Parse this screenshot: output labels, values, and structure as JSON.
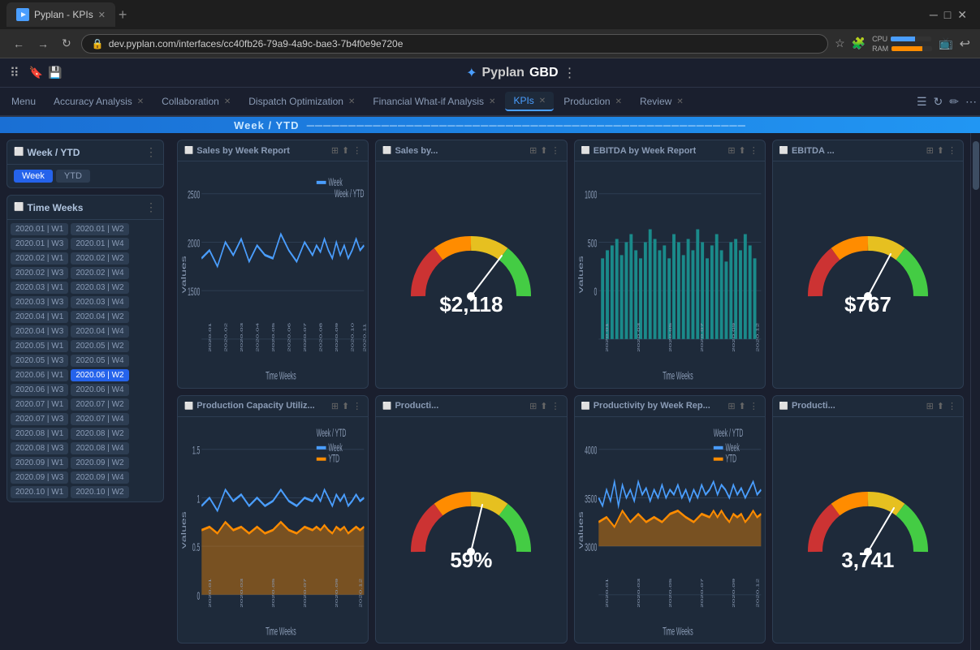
{
  "browser": {
    "tab_title": "Pyplan - KPIs",
    "url": "dev.pyplan.com/interfaces/cc40fb26-79a9-4a9c-bae3-7b4f0e9e720e",
    "new_tab_label": "+"
  },
  "app": {
    "name": "Pyplan",
    "workspace": "GBD",
    "menu_label": "Menu",
    "tabs": [
      {
        "id": "accuracy",
        "label": "Accuracy Analysis",
        "closable": true
      },
      {
        "id": "collaboration",
        "label": "Collaboration",
        "closable": true
      },
      {
        "id": "dispatch",
        "label": "Dispatch Optimization",
        "closable": true
      },
      {
        "id": "financial",
        "label": "Financial What-if Analysis",
        "closable": true
      },
      {
        "id": "kpis",
        "label": "KPIs",
        "closable": true,
        "active": true
      },
      {
        "id": "production",
        "label": "Production",
        "closable": true
      },
      {
        "id": "review",
        "label": "Review",
        "closable": true
      }
    ]
  },
  "banner": {
    "text": "Week / YTD"
  },
  "sidebar": {
    "week_ytd": {
      "title": "Week / YTD",
      "btn_week": "Week",
      "btn_ytd": "YTD"
    },
    "time_weeks": {
      "title": "Time Weeks"
    },
    "weeks": [
      "2020.01 | W1",
      "2020.01 | W2",
      "2020.01 | W3",
      "2020.01 | W4",
      "2020.02 | W1",
      "2020.02 | W2",
      "2020.02 | W3",
      "2020.02 | W4",
      "2020.03 | W1",
      "2020.03 | W2",
      "2020.03 | W3",
      "2020.03 | W4",
      "2020.04 | W1",
      "2020.04 | W2",
      "2020.04 | W3",
      "2020.04 | W4",
      "2020.05 | W1",
      "2020.05 | W2",
      "2020.05 | W3",
      "2020.05 | W4",
      "2020.06 | W1",
      "2020.06 | W2",
      "2020.06 | W3",
      "2020.06 | W4",
      "2020.07 | W1",
      "2020.07 | W2",
      "2020.07 | W3",
      "2020.07 | W4",
      "2020.08 | W1",
      "2020.08 | W2",
      "2020.08 | W3",
      "2020.08 | W4",
      "2020.09 | W1",
      "2020.09 | W2",
      "2020.09 | W3",
      "2020.09 | W4",
      "2020.10 | W1",
      "2020.10 | W2"
    ],
    "active_week": "2020.06 | W2"
  },
  "cards": [
    {
      "id": "sales-week",
      "title": "Sales by Week Report",
      "type": "line_chart",
      "value": null,
      "has_legend": true,
      "legend_label": "Week / YTD"
    },
    {
      "id": "sales-gauge",
      "title": "Sales by...",
      "type": "gauge",
      "value": "$2,118",
      "gauge_pct": 0.72
    },
    {
      "id": "ebitda-week",
      "title": "EBITDA by Week Report",
      "type": "bar_chart",
      "value": null,
      "has_legend": false
    },
    {
      "id": "ebitda-gauge",
      "title": "EBITDA ...",
      "type": "gauge",
      "value": "$767",
      "gauge_pct": 0.65
    },
    {
      "id": "prod-capacity",
      "title": "Production Capacity Utiliz...",
      "type": "line_chart2",
      "value": null,
      "has_legend": true,
      "legend_label": "Week / YTD"
    },
    {
      "id": "producti-gauge",
      "title": "Producti...",
      "type": "gauge",
      "value": "59%",
      "gauge_pct": 0.59
    },
    {
      "id": "productivity-week",
      "title": "Productivity by Week Rep...",
      "type": "line_chart3",
      "value": null,
      "has_legend": true,
      "legend_label": "Week / YTD"
    },
    {
      "id": "producti-gauge2",
      "title": "Producti...",
      "type": "gauge2",
      "value": "3,741",
      "gauge_pct": 0.62
    }
  ],
  "cpu": {
    "label": "CPU",
    "ram_label": "RAM",
    "cpu_pct": 60,
    "ram_pct": 75
  }
}
